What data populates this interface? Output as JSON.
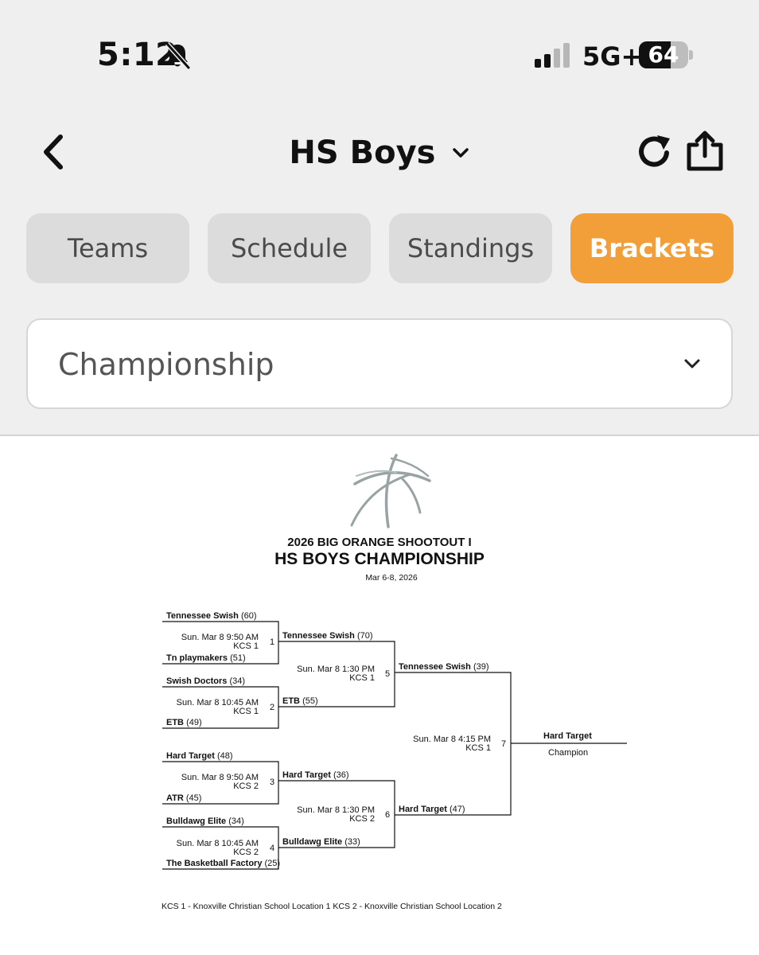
{
  "status_bar": {
    "time": "5:12",
    "network": "5G+",
    "battery": "64",
    "battery_level": 0.64
  },
  "nav": {
    "title": "HS Boys"
  },
  "tabs": [
    {
      "label": "Teams",
      "active": false
    },
    {
      "label": "Schedule",
      "active": false
    },
    {
      "label": "Standings",
      "active": false
    },
    {
      "label": "Brackets",
      "active": true
    }
  ],
  "bracket_select": {
    "value": "Championship"
  },
  "colors": {
    "accent": "#f29f3a",
    "tab_bg": "#dcdcdc",
    "top_bg": "#efeff0"
  },
  "icons": [
    "bell-off-icon",
    "signal-icon",
    "back-icon",
    "chevron-down-icon",
    "refresh-icon",
    "share-icon",
    "basketball-icon"
  ],
  "bracket": {
    "event": "2026 BIG ORANGE SHOOTOUT I",
    "title": "HS BOYS CHAMPIONSHIP",
    "dates": "Mar 6-8, 2026",
    "round1": [
      {
        "top": {
          "name": "Tennessee Swish",
          "score": "(60)"
        },
        "bottom": {
          "name": "Tn playmakers",
          "score": "(51)"
        },
        "time": "Sun. Mar 8 9:50 AM",
        "court": "KCS 1",
        "game": "1"
      },
      {
        "top": {
          "name": "Swish Doctors",
          "score": "(34)"
        },
        "bottom": {
          "name": "ETB",
          "score": "(49)"
        },
        "time": "Sun. Mar 8 10:45 AM",
        "court": "KCS 1",
        "game": "2"
      },
      {
        "top": {
          "name": "Hard Target",
          "score": "(48)"
        },
        "bottom": {
          "name": "ATR",
          "score": "(45)"
        },
        "time": "Sun. Mar 8 9:50 AM",
        "court": "KCS 2",
        "game": "3"
      },
      {
        "top": {
          "name": "Bulldawg Elite",
          "score": "(34)"
        },
        "bottom": {
          "name": "The Basketball Factory",
          "score": "(25)"
        },
        "time": "Sun. Mar 8 10:45 AM",
        "court": "KCS 2",
        "game": "4"
      }
    ],
    "round2": [
      {
        "top": {
          "name": "Tennessee Swish",
          "score": "(70)"
        },
        "bottom": {
          "name": "ETB",
          "score": "(55)"
        },
        "time": "Sun. Mar 8 1:30 PM",
        "court": "KCS 1",
        "game": "5"
      },
      {
        "top": {
          "name": "Hard Target",
          "score": "(36)"
        },
        "bottom": {
          "name": "Bulldawg Elite",
          "score": "(33)"
        },
        "time": "Sun. Mar 8 1:30 PM",
        "court": "KCS 2",
        "game": "6"
      }
    ],
    "final": {
      "top": {
        "name": "Tennessee Swish",
        "score": "(39)"
      },
      "bottom": {
        "name": "Hard Target",
        "score": "(47)"
      },
      "time": "Sun. Mar 8 4:15 PM",
      "court": "KCS 1",
      "game": "7"
    },
    "champion": {
      "name": "Hard Target",
      "label": "Champion"
    },
    "footnote": "KCS 1 - Knoxville Christian School Location 1   KCS 2 - Knoxville Christian School Location 2"
  }
}
